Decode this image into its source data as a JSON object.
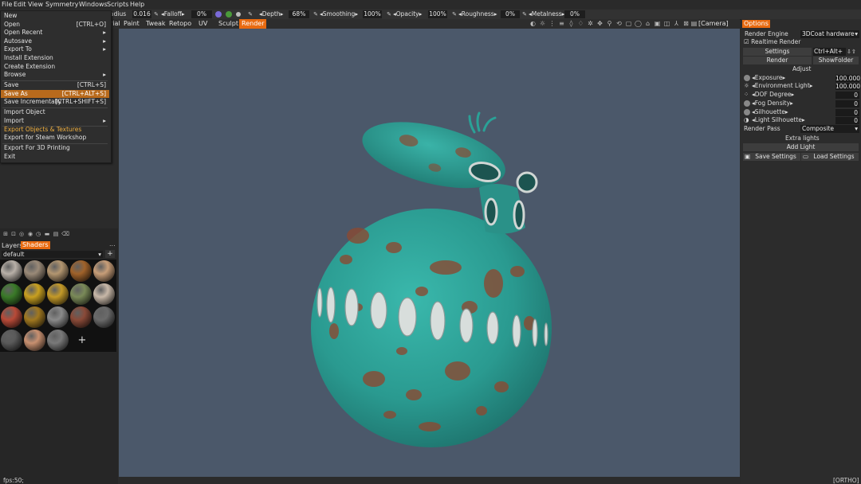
{
  "menu": [
    "File",
    "Edit",
    "View",
    "Symmetry",
    "Windows",
    "Scripts",
    "Help"
  ],
  "toolbar": {
    "radius_label": "adius",
    "radius_value": "0.016",
    "falloff_label": "Falloff",
    "falloff_value": "0%",
    "depth_label": "Depth",
    "depth_value": "68%",
    "smoothing_label": "Smoothing",
    "smoothing_value": "100%",
    "opacity_label": "Opacity",
    "opacity_value": "100%",
    "roughness_label": "Roughness",
    "roughness_value": "0%",
    "metalness_label": "Metalness",
    "metalness_value": "0%"
  },
  "rooms": [
    "rial",
    "Paint",
    "Tweak",
    "Retopo",
    "UV",
    "Sculpt",
    "Render"
  ],
  "active_room": "Render",
  "camera_label": "[Camera]",
  "file_menu": [
    {
      "label": "New",
      "shortcut": ""
    },
    {
      "label": "Open",
      "shortcut": "[CTRL+O]"
    },
    {
      "label": "Open Recent",
      "shortcut": "▸"
    },
    {
      "label": "Autosave",
      "shortcut": "▸"
    },
    {
      "label": "Export To",
      "shortcut": "▸"
    },
    {
      "label": "Install Extension",
      "shortcut": ""
    },
    {
      "label": "Create Extension",
      "shortcut": ""
    },
    {
      "label": "Browse",
      "shortcut": "▸"
    },
    {
      "label": "Save",
      "shortcut": "[CTRL+S]"
    },
    {
      "label": "Save As",
      "shortcut": "[CTRL+ALT+S]"
    },
    {
      "label": "Save Incrementally",
      "shortcut": "[CTRL+SHIFT+S]"
    },
    {
      "label": "Import Object",
      "shortcut": ""
    },
    {
      "label": "Import",
      "shortcut": "▸"
    },
    {
      "label": "Export Objects & Textures",
      "shortcut": ""
    },
    {
      "label": "Export for Steam Workshop",
      "shortcut": ""
    },
    {
      "label": "Export For 3D Printing",
      "shortcut": ""
    },
    {
      "label": "Exit",
      "shortcut": ""
    }
  ],
  "left_panel": {
    "tab_layers": "Layers",
    "tab_shaders": "Shaders",
    "more": "...",
    "shader_set": "default",
    "add": "+",
    "add_shader": "+"
  },
  "shader_colors": [
    "#b8b0a8",
    "#9a8a78",
    "#b39670",
    "#a0622a",
    "#c89e78",
    "#3a7a28",
    "#c8a020",
    "#c49a28",
    "#7a8a58",
    "#c8b8a8",
    "#b84a38",
    "#a07820",
    "#8a8a8a",
    "#8a4a38",
    "#6a6a6a",
    "#5a5a5a",
    "#c89070",
    "#7a7a7a"
  ],
  "right_panel": {
    "tab": "Options",
    "render_engine_label": "Render Engine",
    "render_engine_value": "3DCoat hardware",
    "realtime_render": "Realtime Render",
    "settings": "Settings",
    "settings_shortcut": "Ctrl+Alt+",
    "render": "Render",
    "show_folder": "ShowFolder",
    "adjust": "Adjust",
    "exposure_label": "Exposure",
    "exposure_value": "100.000",
    "env_light_label": "Environment Light",
    "env_light_value": "100.000",
    "dof_label": "DOF Degree",
    "dof_value": "0",
    "fog_label": "Fog Density",
    "fog_value": "0",
    "silhouette_label": "Silhouette",
    "silhouette_value": "0",
    "light_silhouette_label": "Light Silhouette",
    "light_silhouette_value": "0",
    "render_pass_label": "Render Pass",
    "render_pass_value": "Composite",
    "extra_lights": "Extra lights",
    "add_light": "Add Light",
    "save_settings": "Save Settings",
    "load_settings": "Load Settings"
  },
  "status": {
    "fps": "fps:50;",
    "view_mode": "[ORTHO]"
  },
  "colors": {
    "accent": "#e86a10",
    "viewport": "#4b586a",
    "model_teal": "#2fa39a",
    "rust": "#8a4a32"
  }
}
